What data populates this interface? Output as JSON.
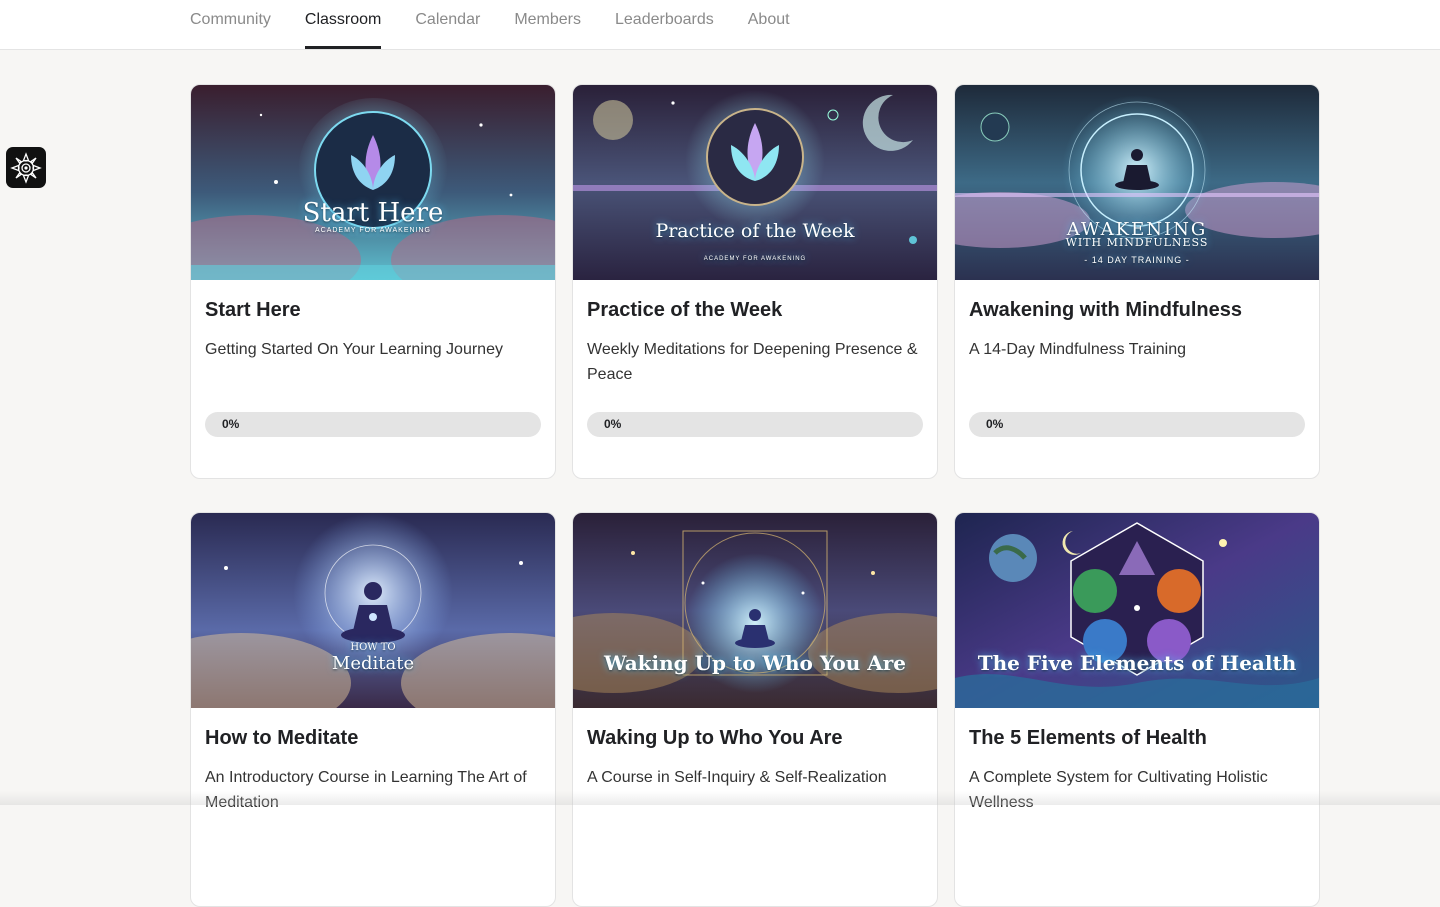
{
  "nav": {
    "tabs": [
      {
        "label": "Community"
      },
      {
        "label": "Classroom"
      },
      {
        "label": "Calendar"
      },
      {
        "label": "Members"
      },
      {
        "label": "Leaderboards"
      },
      {
        "label": "About"
      }
    ],
    "active": "Classroom"
  },
  "sidebar": {
    "logo_icon": "mandala-icon"
  },
  "courses": [
    {
      "title": "Start Here",
      "description": "Getting Started On Your Learning Journey",
      "progress_label": "0%",
      "progress": 0,
      "image": {
        "title": "Start Here",
        "subtitle": "ACADEMY FOR AWAKENING"
      }
    },
    {
      "title": "Practice of the Week",
      "description": "Weekly Meditations for Deepening Presence & Peace",
      "progress_label": "0%",
      "progress": 0,
      "image": {
        "title": "Practice of the Week",
        "subtitle": "ACADEMY FOR AWAKENING"
      }
    },
    {
      "title": "Awakening with Mindfulness",
      "description": "A 14-Day Mindfulness Training",
      "progress_label": "0%",
      "progress": 0,
      "image": {
        "title": "AWAKENING",
        "subtitle": "WITH MINDFULNESS",
        "tag": "- 14 DAY TRAINING -"
      }
    },
    {
      "title": "How to Meditate",
      "description": "An Introductory Course in Learning The Art of Meditation",
      "image": {
        "title": "Meditate",
        "subtitle": "HOW TO"
      }
    },
    {
      "title": "Waking Up to Who You Are",
      "description": "A Course in Self-Inquiry & Self-Realization",
      "image": {
        "title": "Waking Up to Who You Are"
      }
    },
    {
      "title": "The 5 Elements of Health",
      "description": "A Complete System for Cultivating Holistic Wellness",
      "image": {
        "title": "The Five Elements of Health"
      }
    }
  ]
}
